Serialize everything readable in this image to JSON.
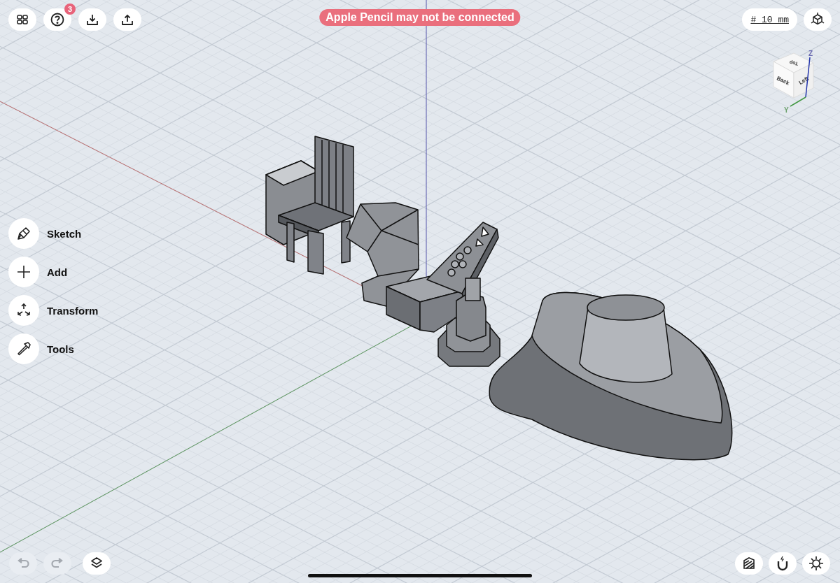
{
  "toolbar": {
    "help_badge": "3"
  },
  "banner": "Apple Pencil may not be connected",
  "grid_size": "# 10 mm",
  "view_cube": {
    "faces": [
      "Top",
      "Back",
      "Left"
    ],
    "axes": [
      "Z",
      "Y"
    ]
  },
  "tools": [
    {
      "label": "Sketch"
    },
    {
      "label": "Add"
    },
    {
      "label": "Transform"
    },
    {
      "label": "Tools"
    }
  ],
  "history": [
    {
      "kind": "undo",
      "disabled": true
    },
    {
      "kind": "redo",
      "disabled": true
    }
  ]
}
